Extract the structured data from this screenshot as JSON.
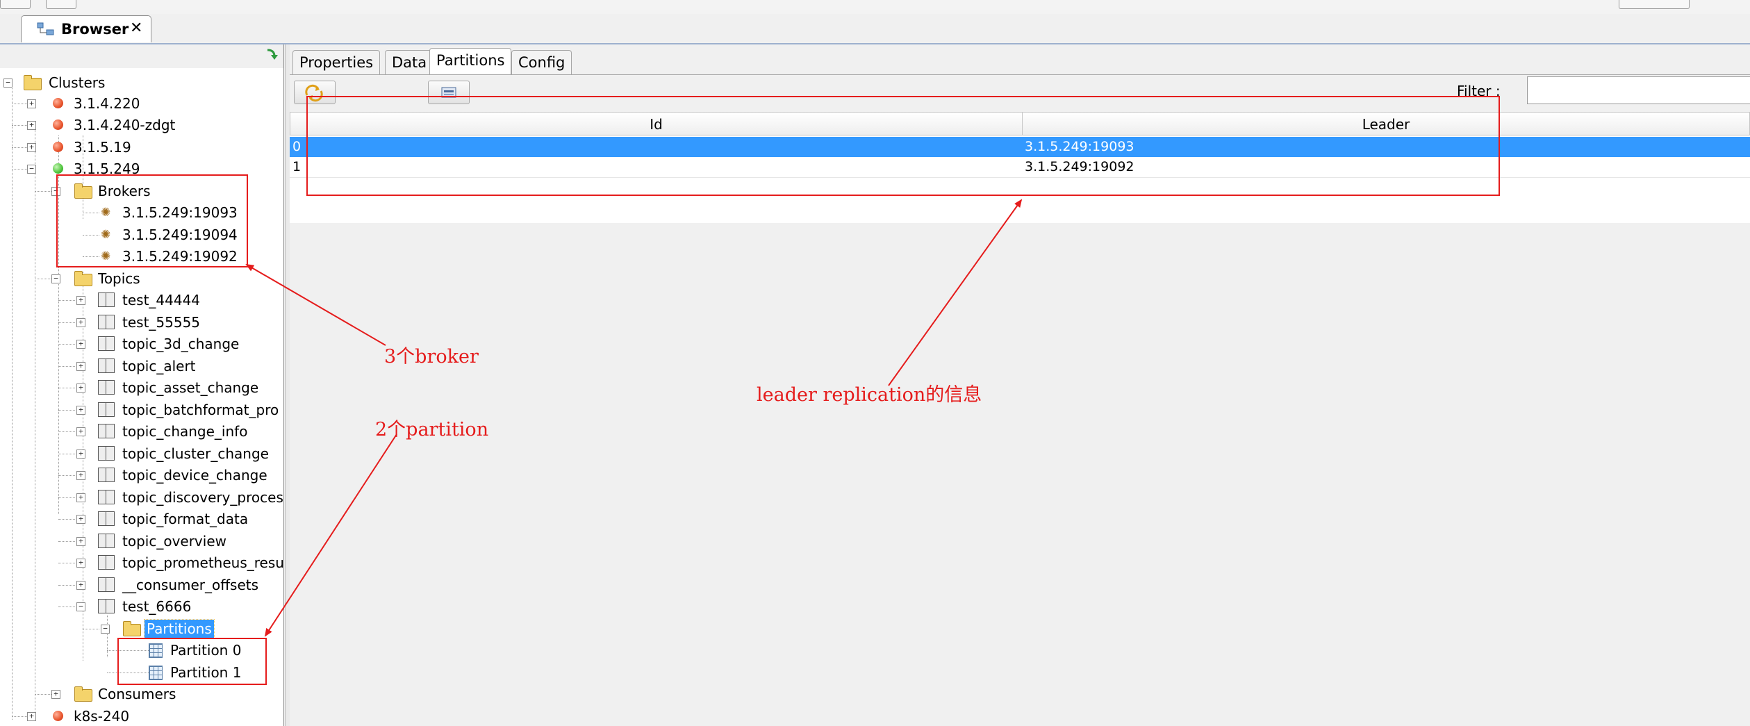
{
  "tab": {
    "title": "Browser",
    "close_glyph": "✕"
  },
  "tree": {
    "clusters_label": "Clusters",
    "cluster_1": "3.1.4.220",
    "cluster_2": "3.1.4.240-zdgt",
    "cluster_3": "3.1.5.19",
    "cluster_4": "3.1.5.249",
    "brokers_label": "Brokers",
    "brokers": [
      "3.1.5.249:19093",
      "3.1.5.249:19094",
      "3.1.5.249:19092"
    ],
    "topics_label": "Topics",
    "topics": [
      "test_44444",
      "test_55555",
      "topic_3d_change",
      "topic_alert",
      "topic_asset_change",
      "topic_batchformat_pro",
      "topic_change_info",
      "topic_cluster_change",
      "topic_device_change",
      "topic_discovery_proces",
      "topic_format_data",
      "topic_overview",
      "topic_prometheus_resu",
      "__consumer_offsets",
      "test_6666"
    ],
    "partitions_label": "Partitions",
    "partitions": [
      "Partition 0",
      "Partition 1"
    ],
    "consumers_label": "Consumers",
    "cluster_5": "k8s-240"
  },
  "right": {
    "tabs": [
      "Properties",
      "Data",
      "Partitions",
      "Config"
    ],
    "active_tab": "Partitions",
    "filter_label": "Filter :",
    "filter_value": "",
    "columns": [
      "Id",
      "Leader"
    ],
    "rows": [
      {
        "id": "0",
        "leader": "3.1.5.249:19093"
      },
      {
        "id": "1",
        "leader": "3.1.5.249:19092"
      }
    ]
  },
  "annotations": {
    "brokers_note": "3个broker",
    "partitions_note": "2个partition",
    "leader_note": "leader replication的信息"
  },
  "colors": {
    "annotation": "#e51c1c",
    "selection": "#3399ff",
    "cluster_error": "#e8532b",
    "cluster_ok": "#4cc43a"
  }
}
